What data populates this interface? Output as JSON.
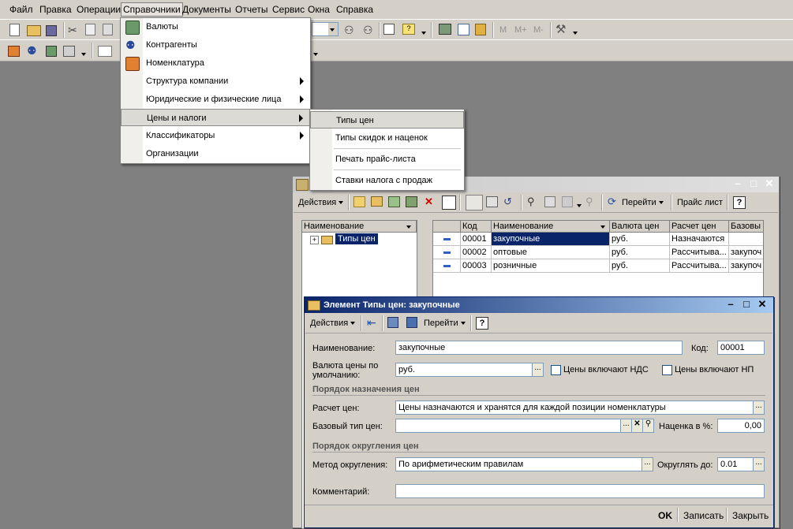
{
  "menubar": [
    "Файл",
    "Правка",
    "Операции",
    "Справочники",
    "Документы",
    "Отчеты",
    "Сервис",
    "Окна",
    "Справка"
  ],
  "toolbar_right": {
    "m": "М",
    "m_plus": "М+",
    "m_minus": "М-"
  },
  "main_menu": {
    "items": [
      {
        "label": "Валюты",
        "icon": "currency-icon"
      },
      {
        "label": "Контрагенты",
        "icon": "contractors-icon"
      },
      {
        "label": "Номенклатура",
        "icon": "nomenclature-icon"
      },
      {
        "label": "Структура компании"
      },
      {
        "label": "Юридические и физические лица"
      },
      {
        "label": "Цены и налоги"
      },
      {
        "label": "Классификаторы"
      },
      {
        "label": "Организации"
      }
    ]
  },
  "submenu": {
    "items": [
      "Типы цен",
      "Типы скидок и наценок",
      "Печать прайс-листа",
      "Ставки налога с продаж"
    ]
  },
  "list_window": {
    "toolbar": {
      "actions": "Действия",
      "goto": "Перейти",
      "price_list": "Прайс лист",
      "help": "?"
    },
    "tree": {
      "header": "Наименование",
      "root": "Типы цен"
    },
    "columns": [
      "Код",
      "Наименование",
      "Валюта цен",
      "Расчет цен",
      "Базовы"
    ],
    "rows": [
      {
        "code": "00001",
        "name": "закупочные",
        "currency": "руб.",
        "calc": "Назначаются",
        "base": ""
      },
      {
        "code": "00002",
        "name": "оптовые",
        "currency": "руб.",
        "calc": "Рассчитыва...",
        "base": "закупоч"
      },
      {
        "code": "00003",
        "name": "розничные",
        "currency": "руб.",
        "calc": "Рассчитыва...",
        "base": "закупоч"
      }
    ]
  },
  "element_window": {
    "title": "Элемент Типы цен: закупочные",
    "toolbar": {
      "actions": "Действия",
      "goto": "Перейти",
      "help": "?"
    },
    "name_label": "Наименование:",
    "name_value": "закупочные",
    "code_label": "Код:",
    "code_value": "00001",
    "currency_label_1": "Валюта цены по",
    "currency_label_2": "умолчанию:",
    "currency_value": "руб.",
    "vat_label": "Цены включают НДС",
    "np_label": "Цены включают НП",
    "group1": "Порядок назначения цен",
    "calc_label": "Расчет цен:",
    "calc_value": "Цены назначаются и хранятся для каждой позиции номенклатуры",
    "base_label": "Базовый тип цен:",
    "base_value": "",
    "markup_label": "Наценка в %:",
    "markup_value": "0,00",
    "group2": "Порядок округления цен",
    "round_method_label": "Метод округления:",
    "round_method_value": "По арифметическим правилам",
    "round_to_label": "Округлять до:",
    "round_to_value": "0.01",
    "comment_label": "Комментарий:",
    "comment_value": "",
    "buttons": {
      "ok": "OK",
      "save": "Записать",
      "close": "Закрыть"
    }
  },
  "colors": {
    "selection": "#0a246a",
    "active_title_start": "#0a246a",
    "active_title_end": "#a6caf0",
    "inactive_title": "#c8c8c8"
  }
}
